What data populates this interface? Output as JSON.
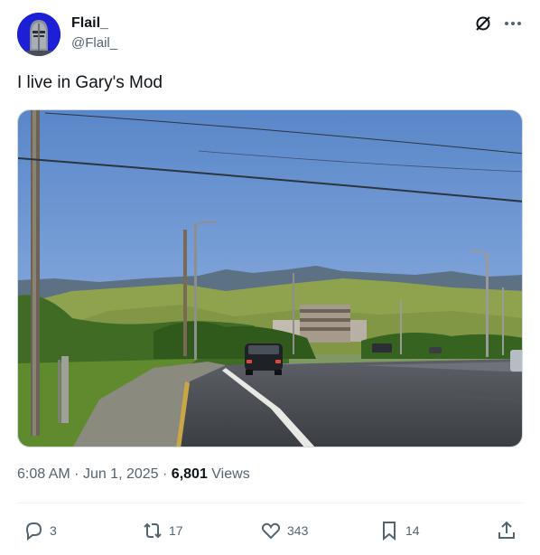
{
  "author": {
    "display_name": "Flail_",
    "handle": "@Flail_",
    "avatar_icon": "knight-helmet-avatar"
  },
  "post": {
    "text": "I live in Gary's Mod",
    "media_alt": "photo"
  },
  "meta": {
    "time": "6:08 AM",
    "separator": "·",
    "date": "Jun 1, 2025",
    "views_count": "6,801",
    "views_label": "Views"
  },
  "actions": {
    "replies": "3",
    "reposts": "17",
    "likes": "343",
    "bookmarks": "14"
  },
  "icons": {
    "grok": "grok-icon",
    "more": "more-icon",
    "reply": "reply-icon",
    "repost": "repost-icon",
    "like": "heart-icon",
    "bookmark": "bookmark-icon",
    "share": "share-icon"
  },
  "colors": {
    "text": "#0f1419",
    "secondary": "#536471",
    "avatar_bg": "#1d1fd6"
  }
}
